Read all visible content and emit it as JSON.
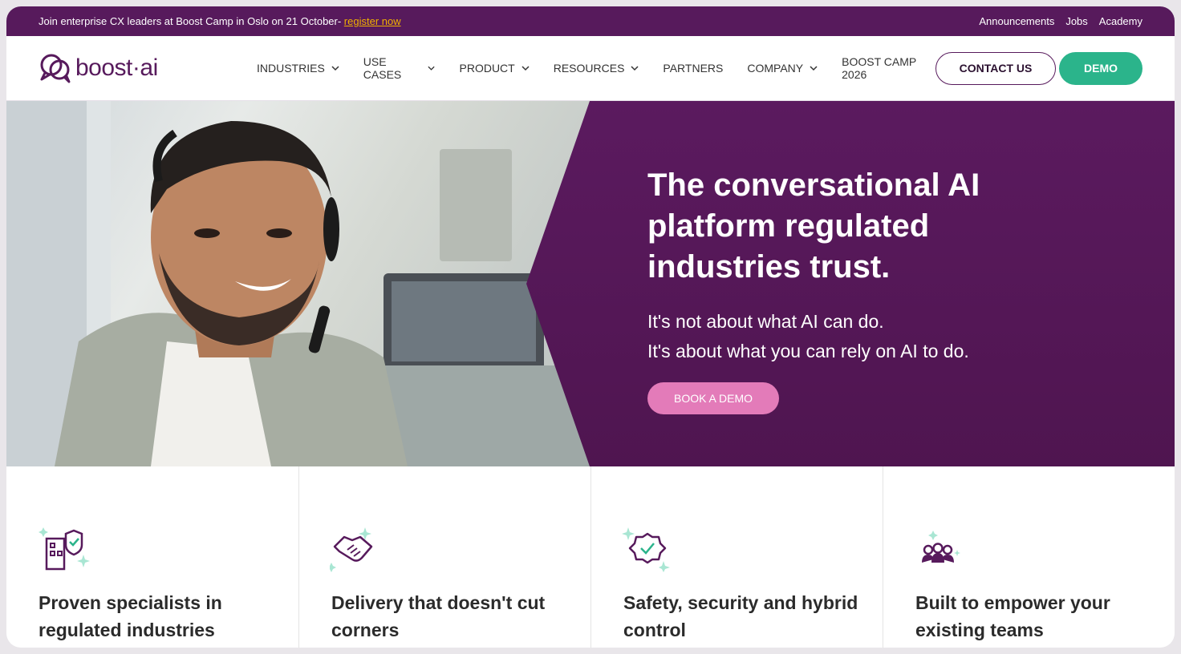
{
  "announcement": {
    "text": "Join enterprise CX leaders at Boost Camp in Oslo on 21 October- ",
    "link": "register now",
    "links": [
      "Announcements",
      "Jobs",
      "Academy"
    ]
  },
  "nav": {
    "logo": "boost·ai",
    "items": [
      {
        "label": "INDUSTRIES",
        "dropdown": true
      },
      {
        "label": "USE CASES",
        "dropdown": true
      },
      {
        "label": "PRODUCT",
        "dropdown": true
      },
      {
        "label": "RESOURCES",
        "dropdown": true
      },
      {
        "label": "PARTNERS",
        "dropdown": false
      },
      {
        "label": "COMPANY",
        "dropdown": true
      },
      {
        "label": "BOOST CAMP 2026",
        "dropdown": false
      }
    ],
    "contact": "CONTACT US",
    "demo": "DEMO"
  },
  "hero": {
    "title": "The conversational AI platform regulated industries trust.",
    "sub1": "It's not about what AI can do.",
    "sub2": "It's about what you can rely on AI to do.",
    "cta": "BOOK A DEMO"
  },
  "features": [
    {
      "icon": "building-shield-icon",
      "title": "Proven specialists in regulated industries"
    },
    {
      "icon": "handshake-icon",
      "title": "Delivery that doesn't cut corners"
    },
    {
      "icon": "badge-check-icon",
      "title": "Safety, security and hybrid control"
    },
    {
      "icon": "team-icon",
      "title": "Built to empower your existing teams"
    }
  ],
  "colors": {
    "brand": "#571a5c",
    "accent_green": "#2bb48b",
    "accent_pink": "#e37bb9",
    "link_yellow": "#f0b100"
  }
}
